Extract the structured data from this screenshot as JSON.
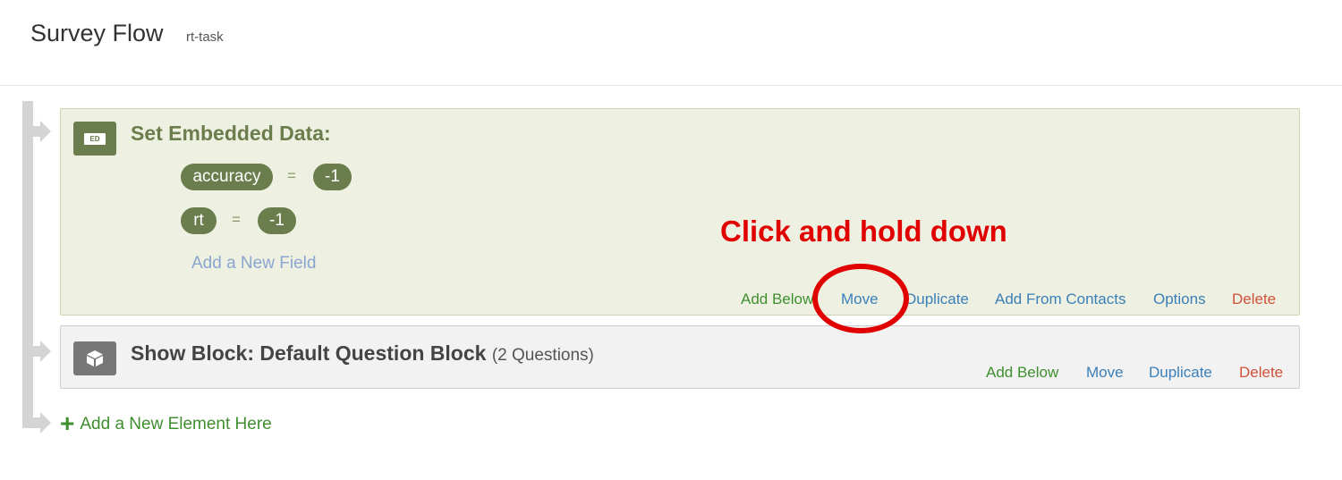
{
  "header": {
    "title": "Survey Flow",
    "survey_name": "rt-task"
  },
  "embedded_data_block": {
    "badge_text": "ED",
    "title": "Set Embedded Data:",
    "fields": [
      {
        "name": "accuracy",
        "operator": "=",
        "value": "-1"
      },
      {
        "name": "rt",
        "operator": "=",
        "value": "-1"
      }
    ],
    "add_field_label": "Add a New Field",
    "actions": {
      "add_below": "Add Below",
      "move": "Move",
      "duplicate": "Duplicate",
      "add_from_contacts": "Add From Contacts",
      "options": "Options",
      "delete": "Delete"
    }
  },
  "show_block": {
    "icon": "cube-icon",
    "title": "Show Block: Default Question Block",
    "count": "(2 Questions)",
    "actions": {
      "add_below": "Add Below",
      "move": "Move",
      "duplicate": "Duplicate",
      "delete": "Delete"
    }
  },
  "add_element": {
    "icon": "plus-icon",
    "label": "Add a New Element Here"
  },
  "annotation": {
    "text": "Click and hold down",
    "color": "#e00000"
  },
  "colors": {
    "ed_accent": "#6b7d4c",
    "ed_background": "#eef1e2",
    "green_action": "#3f8f2f",
    "blue_action": "#3a7fb8",
    "red_action": "#d0503a"
  }
}
